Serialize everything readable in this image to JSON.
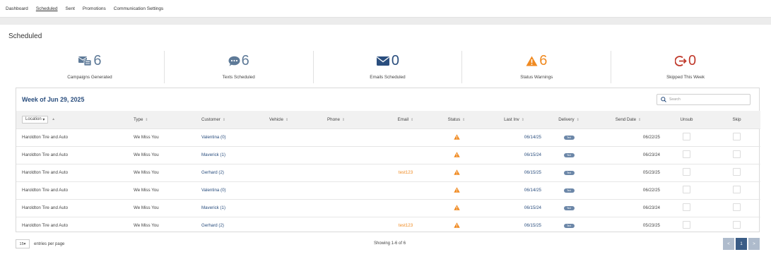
{
  "nav": {
    "items": [
      {
        "label": "Dashboard"
      },
      {
        "label": "Scheduled"
      },
      {
        "label": "Sent"
      },
      {
        "label": "Promotions"
      },
      {
        "label": "Communication Settings"
      }
    ],
    "active": "Scheduled"
  },
  "page": {
    "title": "Scheduled"
  },
  "stats": [
    {
      "icon": "campaigns-icon",
      "value": "6",
      "label": "Campaigns Generated",
      "color": "#5e7a98"
    },
    {
      "icon": "texts-icon",
      "value": "6",
      "label": "Texts Scheduled",
      "color": "#5e7a98"
    },
    {
      "icon": "email-icon",
      "value": "0",
      "label": "Emails Scheduled",
      "color": "#2a4e7e"
    },
    {
      "icon": "warning-icon",
      "value": "6",
      "label": "Status Warnings",
      "color": "#f08a21"
    },
    {
      "icon": "skip-icon",
      "value": "0",
      "label": "Skipped This Week",
      "color": "#c0392b"
    }
  ],
  "panel": {
    "week_title": "Week of Jun 29, 2025",
    "search_placeholder": "Search"
  },
  "table": {
    "location_select": "Location",
    "columns": [
      "Type",
      "Customer",
      "Vehicle",
      "Phone",
      "Email",
      "Status",
      "Last Inv",
      "Delivery",
      "Send Date",
      "Unsub",
      "Skip"
    ],
    "rows": [
      {
        "location": "Haroldton Tire and Auto",
        "type": "We Miss You",
        "customer": "Valentina (0)",
        "vehicle": "",
        "phone": "",
        "email": "",
        "last_inv": "06/14/25",
        "delivery": "Text",
        "send_date": "06/22/25"
      },
      {
        "location": "Haroldton Tire and Auto",
        "type": "We Miss You",
        "customer": "Maverick (1)",
        "vehicle": "",
        "phone": "",
        "email": "",
        "last_inv": "06/15/24",
        "delivery": "Text",
        "send_date": "06/23/24"
      },
      {
        "location": "Haroldton Tire and Auto",
        "type": "We Miss You",
        "customer": "Gerhard (2)",
        "vehicle": "",
        "phone": "",
        "email": "test123",
        "last_inv": "06/15/25",
        "delivery": "Text",
        "send_date": "05/23/25"
      },
      {
        "location": "Haroldton Tire and Auto",
        "type": "We Miss You",
        "customer": "Valentina (0)",
        "vehicle": "",
        "phone": "",
        "email": "",
        "last_inv": "06/14/25",
        "delivery": "Text",
        "send_date": "06/22/25"
      },
      {
        "location": "Haroldton Tire and Auto",
        "type": "We Miss You",
        "customer": "Maverick (1)",
        "vehicle": "",
        "phone": "",
        "email": "",
        "last_inv": "06/15/24",
        "delivery": "Text",
        "send_date": "06/23/24"
      },
      {
        "location": "Haroldton Tire and Auto",
        "type": "We Miss You",
        "customer": "Gerhard (2)",
        "vehicle": "",
        "phone": "",
        "email": "test123",
        "last_inv": "06/15/25",
        "delivery": "Text",
        "send_date": "05/23/25"
      }
    ]
  },
  "footer": {
    "per_page_value": "15",
    "per_page_label": "entries per page",
    "showing": "Showing 1-6 of 6",
    "pager": {
      "prev": "<",
      "current": "1",
      "next": ">"
    }
  }
}
